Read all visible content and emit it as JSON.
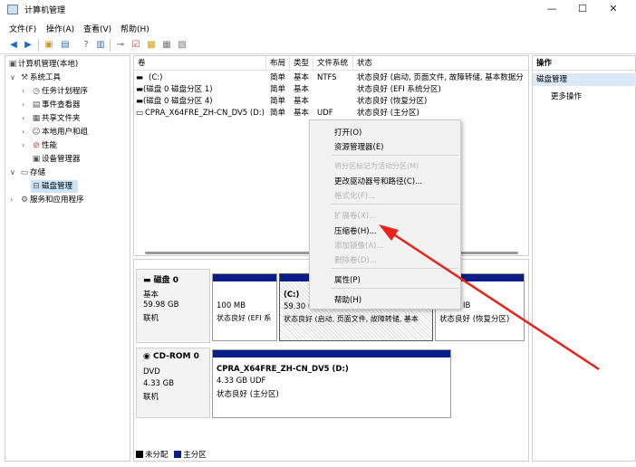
{
  "title": "计算机管理",
  "window_controls": [
    "—",
    "☐",
    "✕"
  ],
  "menu": [
    "文件(F)",
    "操作(A)",
    "查看(V)",
    "帮助(H)"
  ],
  "tree": {
    "root": "计算机管理(本地)",
    "system_tools": "系统工具",
    "task_scheduler": "任务计划程序",
    "event_viewer": "事件查看器",
    "shared_folders": "共享文件夹",
    "local_users": "本地用户和组",
    "performance": "性能",
    "device_manager": "设备管理器",
    "storage": "存储",
    "disk_management": "磁盘管理",
    "services": "服务和应用程序"
  },
  "volume_list": {
    "headers": [
      "卷",
      "布局",
      "类型",
      "文件系统",
      "状态"
    ],
    "rows": [
      {
        "vol": "(C:)",
        "layout": "简单",
        "type": "基本",
        "fs": "NTFS",
        "status": "状态良好 (启动, 页面文件, 故障转储, 基本数据分"
      },
      {
        "vol": "(磁盘 0 磁盘分区 1)",
        "layout": "简单",
        "type": "基本",
        "fs": "",
        "status": "状态良好 (EFI 系统分区)"
      },
      {
        "vol": "(磁盘 0 磁盘分区 4)",
        "layout": "简单",
        "type": "基本",
        "fs": "",
        "status": "状态良好 (恢复分区)"
      },
      {
        "vol": "CPRA_X64FRE_ZH-CN_DV5 (D:)",
        "layout": "简单",
        "type": "基本",
        "fs": "UDF",
        "status": "状态良好 (主分区)"
      }
    ]
  },
  "disk0": {
    "title": "磁盘 0",
    "type": "基本",
    "size": "59.98 GB",
    "state": "联机",
    "p1": {
      "size": "100 MB",
      "status": "状态良好 (EFI 系"
    },
    "p2": {
      "name": "(C:)",
      "size": "59.30 G",
      "status": "状态良好 (启动, 页面文件, 故障转储, 基本"
    },
    "p3": {
      "size": "IB",
      "status": "状态良好 (恢复分区)"
    }
  },
  "cdrom0": {
    "title": "CD-ROM 0",
    "type": "DVD",
    "size": "4.33 GB",
    "state": "联机",
    "vol_name": "CPRA_X64FRE_ZH-CN_DV5  (D:)",
    "vol_size": "4.33 GB UDF",
    "vol_status": "状态良好 (主分区)"
  },
  "legend": {
    "unallocated": "未分配",
    "primary": "主分区"
  },
  "actions": {
    "header": "操作",
    "section": "磁盘管理",
    "more": "更多操作"
  },
  "context_menu": {
    "open": "打开(O)",
    "explore": "资源管理器(E)",
    "mark_active": "将分区标记为活动分区(M)",
    "change_letter": "更改驱动器号和路径(C)...",
    "format": "格式化(F)...",
    "extend": "扩展卷(X)...",
    "shrink": "压缩卷(H)...",
    "add_mirror": "添加镜像(A)...",
    "delete": "删除卷(D)...",
    "properties": "属性(P)",
    "help": "帮助(H)"
  },
  "colors": {
    "primary_partition": "#0a1e8a",
    "unallocated": "#000000",
    "arrow": "#e8231a",
    "selection": "#cce4f7"
  }
}
